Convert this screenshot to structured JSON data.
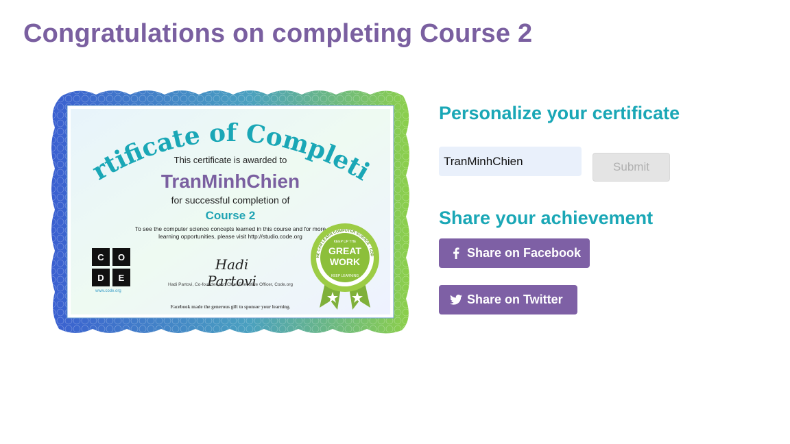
{
  "page": {
    "title": "Congratulations on completing Course 2"
  },
  "certificate": {
    "heading": "Certificate of Completion",
    "awarded_text": "This certificate is awarded to",
    "recipient_name": "TranMinhChien",
    "completion_text": "for successful completion of",
    "course_name": "Course 2",
    "visit_text": "To see the computer science concepts learned in this course and for more learning opportunities, please visit http://studio.code.org",
    "signature": "Hadi Partovi",
    "signer_text": "Hadi Partovi, Co-founder and Chief Executive Officer, Code.org",
    "sponsor_text": "Facebook made the generous gift to sponsor your learning.",
    "logo_letters": [
      "C",
      "O",
      "D",
      "E"
    ],
    "logo_url": "www.code.org",
    "badge": {
      "ring_text": "ANYONE CAN LEARN COMPUTER SCIENCE · CODE.ORG",
      "top_text": "KEEP UP THE",
      "line1": "GREAT",
      "line2": "WORK",
      "bottom_text": "KEEP LEARNING"
    }
  },
  "personalize": {
    "heading": "Personalize your certificate",
    "name_value": "TranMinhChien",
    "submit_label": "Submit"
  },
  "share": {
    "heading": "Share your achievement",
    "facebook_label": "Share on Facebook",
    "twitter_label": "Share on Twitter"
  },
  "colors": {
    "title_purple": "#7a5fa0",
    "heading_teal": "#1aa7b6",
    "button_purple": "#7e60a5",
    "input_bg": "#e9f0fb",
    "submit_disabled": "#e4e4e4"
  }
}
